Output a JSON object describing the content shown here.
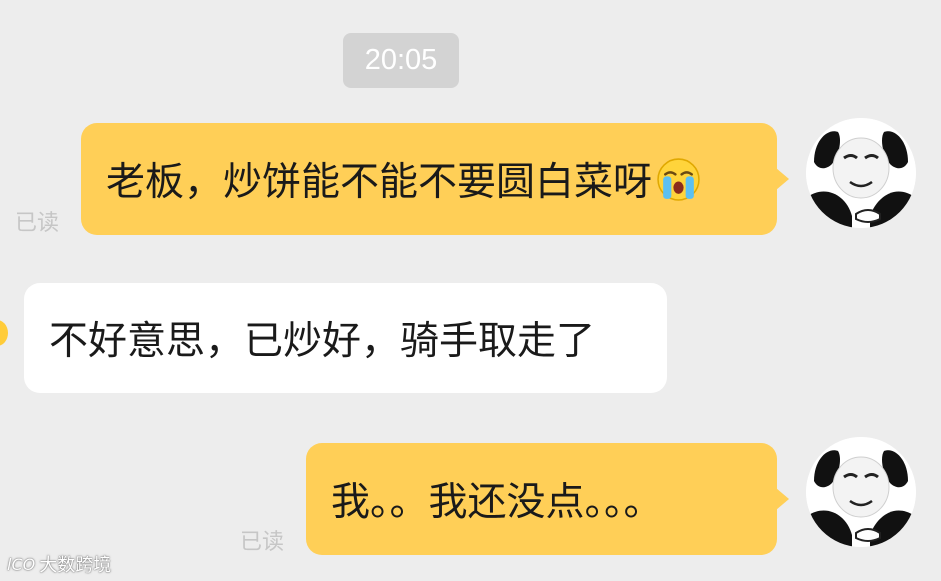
{
  "chat": {
    "timestamp": "20:05",
    "messages": [
      {
        "direction": "outgoing",
        "text": "老板，炒饼能不能不要圆白菜呀",
        "emoji": "crying-face-emoji",
        "read_receipt": "已读"
      },
      {
        "direction": "incoming",
        "text": "不好意思，已炒好，骑手取走了"
      },
      {
        "direction": "outgoing",
        "text": "我。。我还没点。。。",
        "read_receipt": "已读"
      }
    ]
  },
  "watermark": {
    "logo": "lCO",
    "text": "大数跨境"
  },
  "colors": {
    "background": "#ededed",
    "outgoing_bubble": "#ffcf57",
    "incoming_bubble": "#ffffff",
    "timestamp_bg": "#d3d3d3",
    "read_receipt": "#c6c6c6"
  },
  "icons": {
    "avatar": "panda-meme-avatar-icon",
    "emoji": "crying-face-emoji-icon"
  }
}
